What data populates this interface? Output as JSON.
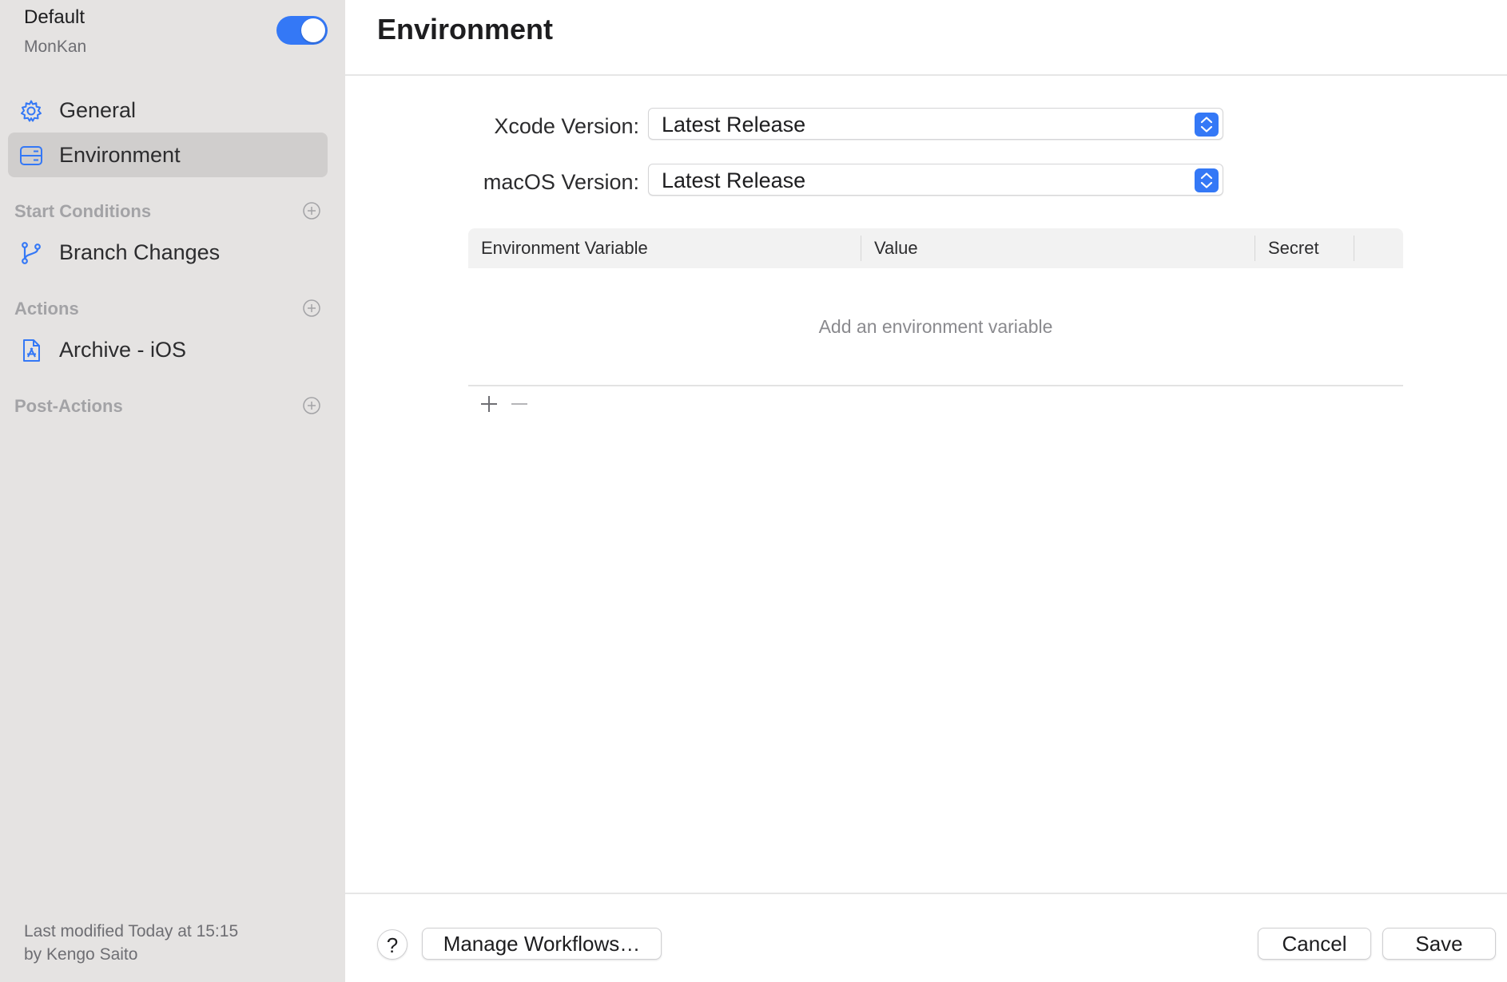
{
  "sidebar": {
    "workflow": {
      "title": "Default",
      "subtitle": "MonKan",
      "enabled": true
    },
    "items": [
      {
        "label": "General",
        "icon": "gear-icon",
        "selected": false
      },
      {
        "label": "Environment",
        "icon": "server-icon",
        "selected": true
      }
    ],
    "sections": [
      {
        "title": "Start Conditions",
        "items": [
          {
            "label": "Branch Changes",
            "icon": "branch-icon"
          }
        ]
      },
      {
        "title": "Actions",
        "items": [
          {
            "label": "Archive - iOS",
            "icon": "app-store-icon"
          }
        ]
      },
      {
        "title": "Post-Actions",
        "items": []
      }
    ],
    "last_modified": {
      "line1": "Last modified Today at 15:15",
      "line2": "by Kengo Saito"
    }
  },
  "main": {
    "title": "Environment",
    "xcode": {
      "label": "Xcode Version:",
      "value": "Latest Release"
    },
    "macos": {
      "label": "macOS Version:",
      "value": "Latest Release"
    },
    "table": {
      "columns": [
        "Environment Variable",
        "Value",
        "Secret"
      ],
      "empty_text": "Add an environment variable",
      "add_label": "+",
      "remove_label": "−"
    }
  },
  "footer": {
    "help_label": "?",
    "manage_label": "Manage Workflows…",
    "cancel_label": "Cancel",
    "save_label": "Save"
  },
  "colors": {
    "accent": "#3478f6",
    "sidebar_bg": "#e5e3e2",
    "selected_bg": "#d0cecd"
  }
}
